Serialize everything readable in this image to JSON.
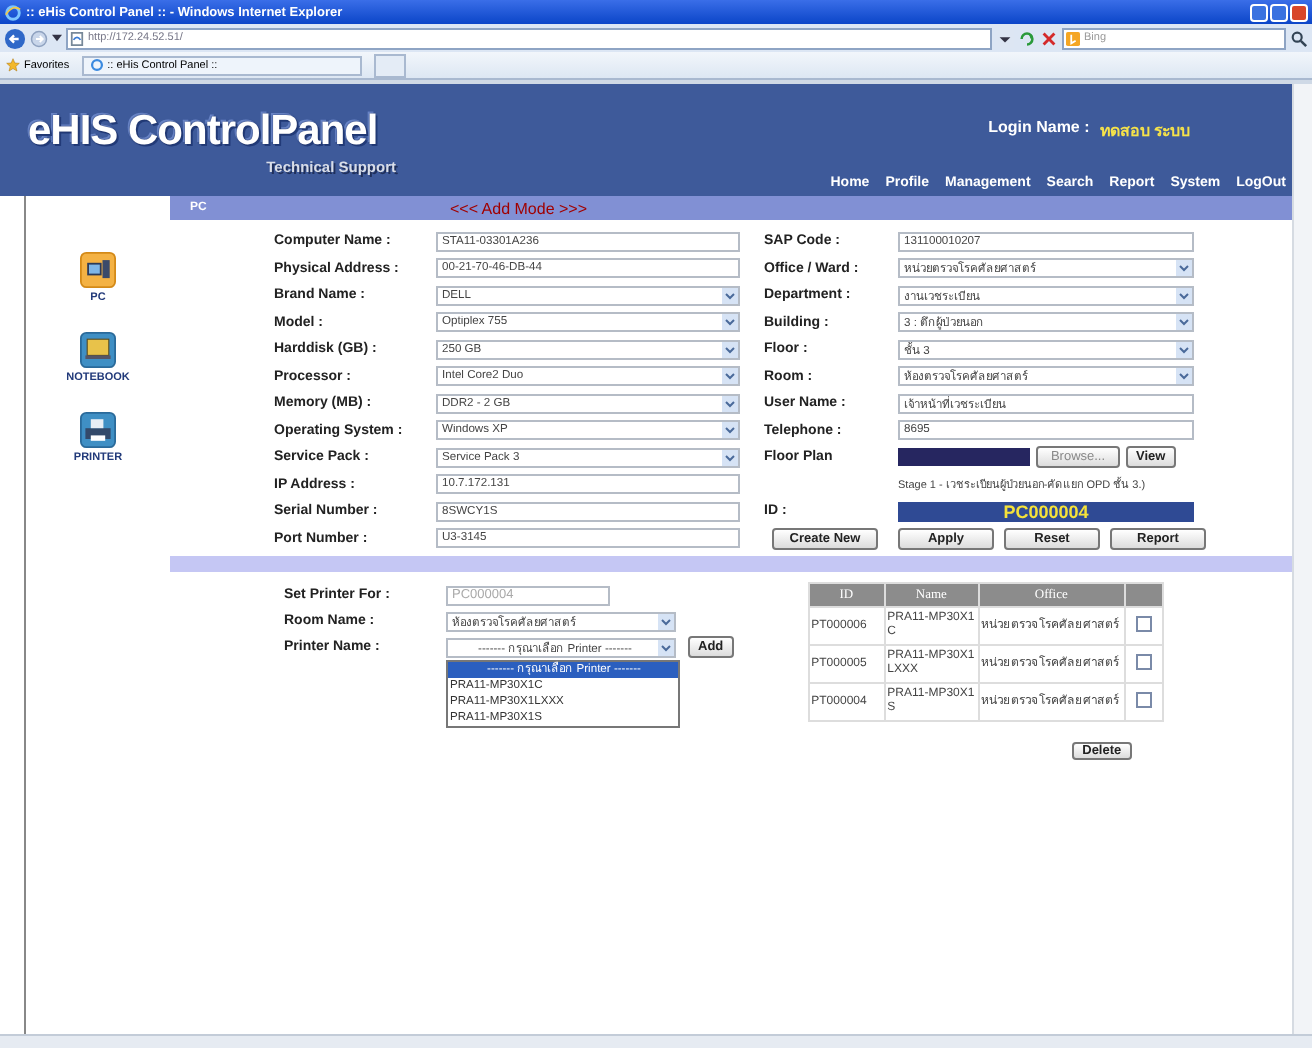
{
  "window": {
    "title": ":: eHis Control Panel :: - Windows Internet Explorer"
  },
  "browser": {
    "address": "http://172.24.52.51/",
    "search_placeholder": "Bing",
    "favorites": "Favorites",
    "tab": ":: eHis Control Panel ::"
  },
  "header": {
    "logo": "eHIS ControlPanel",
    "subtitle": "Technical Support",
    "login_label": "Login Name :",
    "login_name": "ทดสอบ ระบบ",
    "nav": [
      "Home",
      "Profile",
      "Management",
      "Search",
      "Report",
      "System",
      "LogOut"
    ]
  },
  "sidebar": {
    "items": [
      {
        "label": "PC",
        "kind": "pc",
        "selected": true
      },
      {
        "label": "NOTEBOOK",
        "kind": "notebook",
        "selected": false
      },
      {
        "label": "PRINTER",
        "kind": "printer",
        "selected": false
      }
    ]
  },
  "mode_bar": {
    "section": "PC",
    "mode": "<<< Add Mode >>>"
  },
  "left_fields": [
    {
      "label": "Computer Name :",
      "value": "STA11-03301A236",
      "kind": "text"
    },
    {
      "label": "Physical Address :",
      "value": "00-21-70-46-DB-44",
      "kind": "text"
    },
    {
      "label": "Brand Name :",
      "value": "DELL",
      "kind": "select"
    },
    {
      "label": "Model :",
      "value": "Optiplex 755",
      "kind": "select"
    },
    {
      "label": "Harddisk (GB) :",
      "value": "250 GB",
      "kind": "select"
    },
    {
      "label": "Processor :",
      "value": "Intel Core2 Duo",
      "kind": "select"
    },
    {
      "label": "Memory (MB) :",
      "value": "DDR2 - 2 GB",
      "kind": "select"
    },
    {
      "label": "Operating System :",
      "value": "Windows XP",
      "kind": "select"
    },
    {
      "label": "Service Pack :",
      "value": "Service Pack 3",
      "kind": "select"
    },
    {
      "label": "IP Address :",
      "value": "10.7.172.131",
      "kind": "text"
    },
    {
      "label": "Serial Number :",
      "value": "8SWCY1S",
      "kind": "text"
    },
    {
      "label": "Port Number :",
      "value": "U3-3145",
      "kind": "text"
    }
  ],
  "right_fields": [
    {
      "label": "SAP Code :",
      "value": "131100010207",
      "kind": "text"
    },
    {
      "label": "Office / Ward :",
      "value": "หน่วยตรวจโรคศัลยศาสตร์",
      "kind": "select"
    },
    {
      "label": "Department :",
      "value": "งานเวชระเบียน",
      "kind": "select"
    },
    {
      "label": "Building :",
      "value": "3 : ตึกผู้ป่วยนอก",
      "kind": "select"
    },
    {
      "label": "Floor :",
      "value": "ชั้น 3",
      "kind": "select"
    },
    {
      "label": "Room :",
      "value": "ห้องตรวจโรคศัลยศาสตร์",
      "kind": "select"
    },
    {
      "label": "User Name :",
      "value": "เจ้าหน้าที่เวชระเบียน",
      "kind": "text"
    },
    {
      "label": "Telephone :",
      "value": "8695",
      "kind": "text"
    }
  ],
  "floor_plan": {
    "label": "Floor Plan",
    "browse": "Browse...",
    "view": "View",
    "note": "Stage 1 - เวชระเบียนผู้ป่วยนอก-คัดแยก OPD ชั้น 3.)"
  },
  "id_field": {
    "label": "ID :",
    "value": "PC000004"
  },
  "buttons": [
    "Create New",
    "Apply",
    "Reset",
    "Report"
  ],
  "printer_form": {
    "set_label": "Set Printer For :",
    "set_value": "PC000004",
    "room_label": "Room Name :",
    "room_value": "ห้องตรวจโรคศัลยศาสตร์",
    "printer_label": "Printer Name :",
    "printer_value": "------- กรุณาเลือก Printer -------",
    "add": "Add",
    "options": [
      {
        "label": "------- กรุณาเลือก Printer -------",
        "selected": true
      },
      {
        "label": "PRA11-MP30X1C",
        "selected": false
      },
      {
        "label": "PRA11-MP30X1LXXX",
        "selected": false
      },
      {
        "label": "PRA11-MP30X1S",
        "selected": false
      }
    ]
  },
  "printer_table": {
    "columns": [
      "ID",
      "Name",
      "Office"
    ],
    "rows": [
      {
        "id": "PT000006",
        "name": "PRA11-MP30X1C",
        "office": "หน่วยตรวจโรคศัลยศาสตร์",
        "checked": false
      },
      {
        "id": "PT000005",
        "name": "PRA11-MP30X1LXXX",
        "office": "หน่วยตรวจโรคศัลยศาสตร์",
        "checked": false
      },
      {
        "id": "PT000004",
        "name": "PRA11-MP30X1S",
        "office": "หน่วยตรวจโรคศัลยศาสตร์",
        "checked": false
      }
    ],
    "delete": "Delete"
  }
}
